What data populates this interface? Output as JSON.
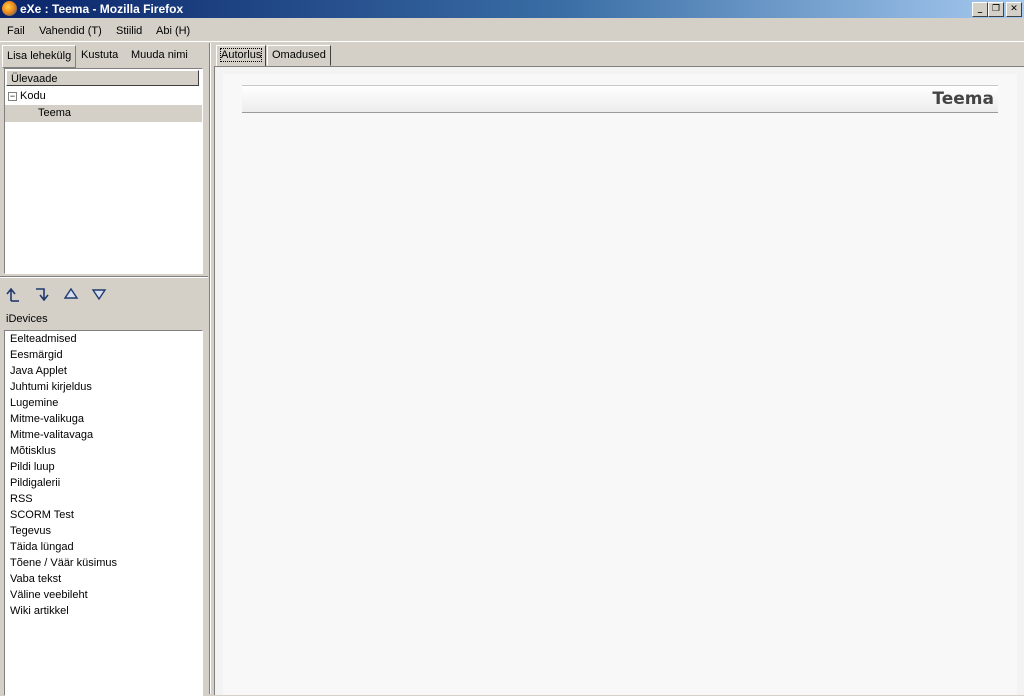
{
  "window": {
    "title": "eXe : Teema - Mozilla Firefox"
  },
  "menu": {
    "items": [
      "Fail",
      "Vahendid (T)",
      "Stiilid",
      "Abi (H)"
    ]
  },
  "left_panel": {
    "tabs": [
      "Lisa lehekülg",
      "Kustuta",
      "Muuda nimi"
    ],
    "outline": {
      "header": "Ülevaade",
      "nodes": [
        "Kodu",
        "Teema"
      ],
      "expander_glyph": "−"
    },
    "idevices": {
      "label": "iDevices",
      "items": [
        "Eelteadmised",
        "Eesmärgid",
        "Java Applet",
        "Juhtumi kirjeldus",
        "Lugemine",
        "Mitme-valikuga",
        "Mitme-valitavaga",
        "Mõtisklus",
        "Pildi luup",
        "Pildigalerii",
        "RSS",
        "SCORM Test",
        "Tegevus",
        "Täida lüngad",
        "Tõene / Väär küsimus",
        "Vaba tekst",
        "Väline veebileht",
        "Wiki artikkel"
      ]
    },
    "arrow_icons": [
      "promote-icon",
      "demote-icon",
      "move-up-icon",
      "move-down-icon"
    ]
  },
  "right_panel": {
    "tabs": [
      "Autorlus",
      "Omadused"
    ],
    "page_title": "Teema"
  },
  "colors": {
    "titlebar_start": "#0a246a",
    "titlebar_end": "#a6caf0",
    "chrome": "#d4d0c8",
    "content_bg": "#f8f8f8"
  }
}
